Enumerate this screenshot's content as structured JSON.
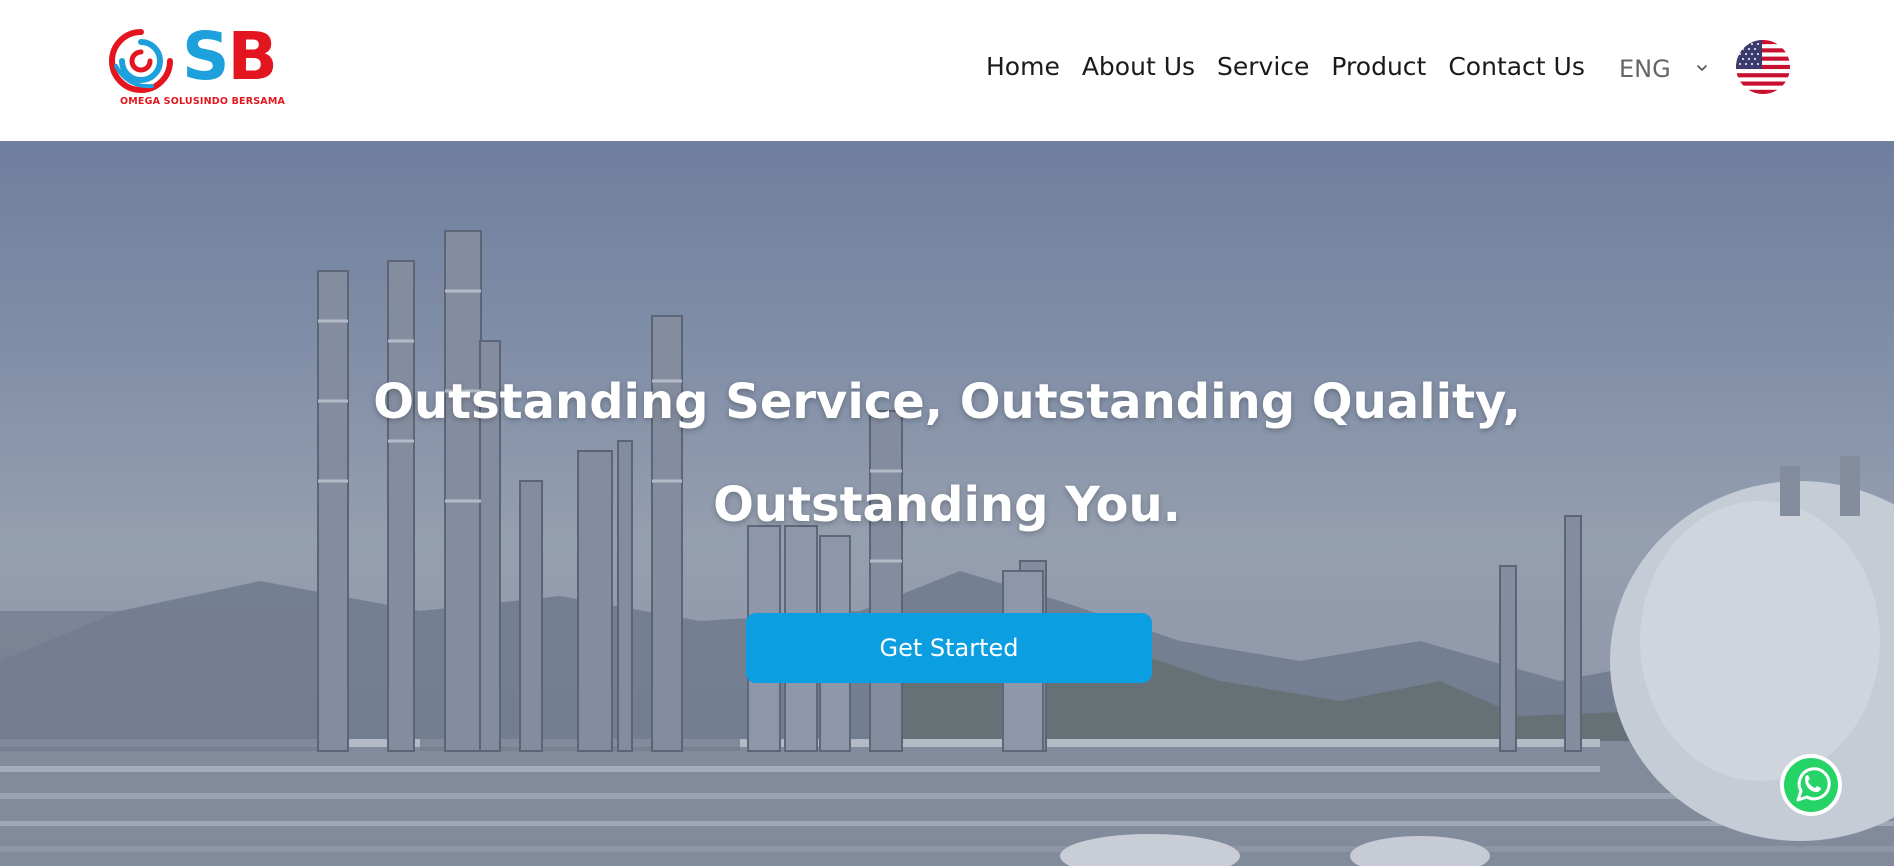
{
  "brand": {
    "letters_s": "S",
    "letters_b": "B",
    "tagline": "OMEGA SOLUSINDO BERSAMA",
    "accent_blue": "#1ea0dc",
    "accent_red": "#e3161f"
  },
  "nav": {
    "items": [
      {
        "label": "Home"
      },
      {
        "label": "About Us"
      },
      {
        "label": "Service"
      },
      {
        "label": "Product"
      },
      {
        "label": "Contact Us"
      }
    ]
  },
  "language": {
    "selected": "ENG",
    "icon": "chevron-down-icon",
    "flag": "us-flag-icon"
  },
  "hero": {
    "title": "Outstanding Service, Outstanding Quality, Outstanding You.",
    "cta_label": "Get Started",
    "cta_color": "#0b9ee0"
  },
  "floating": {
    "icon": "whatsapp-icon"
  }
}
